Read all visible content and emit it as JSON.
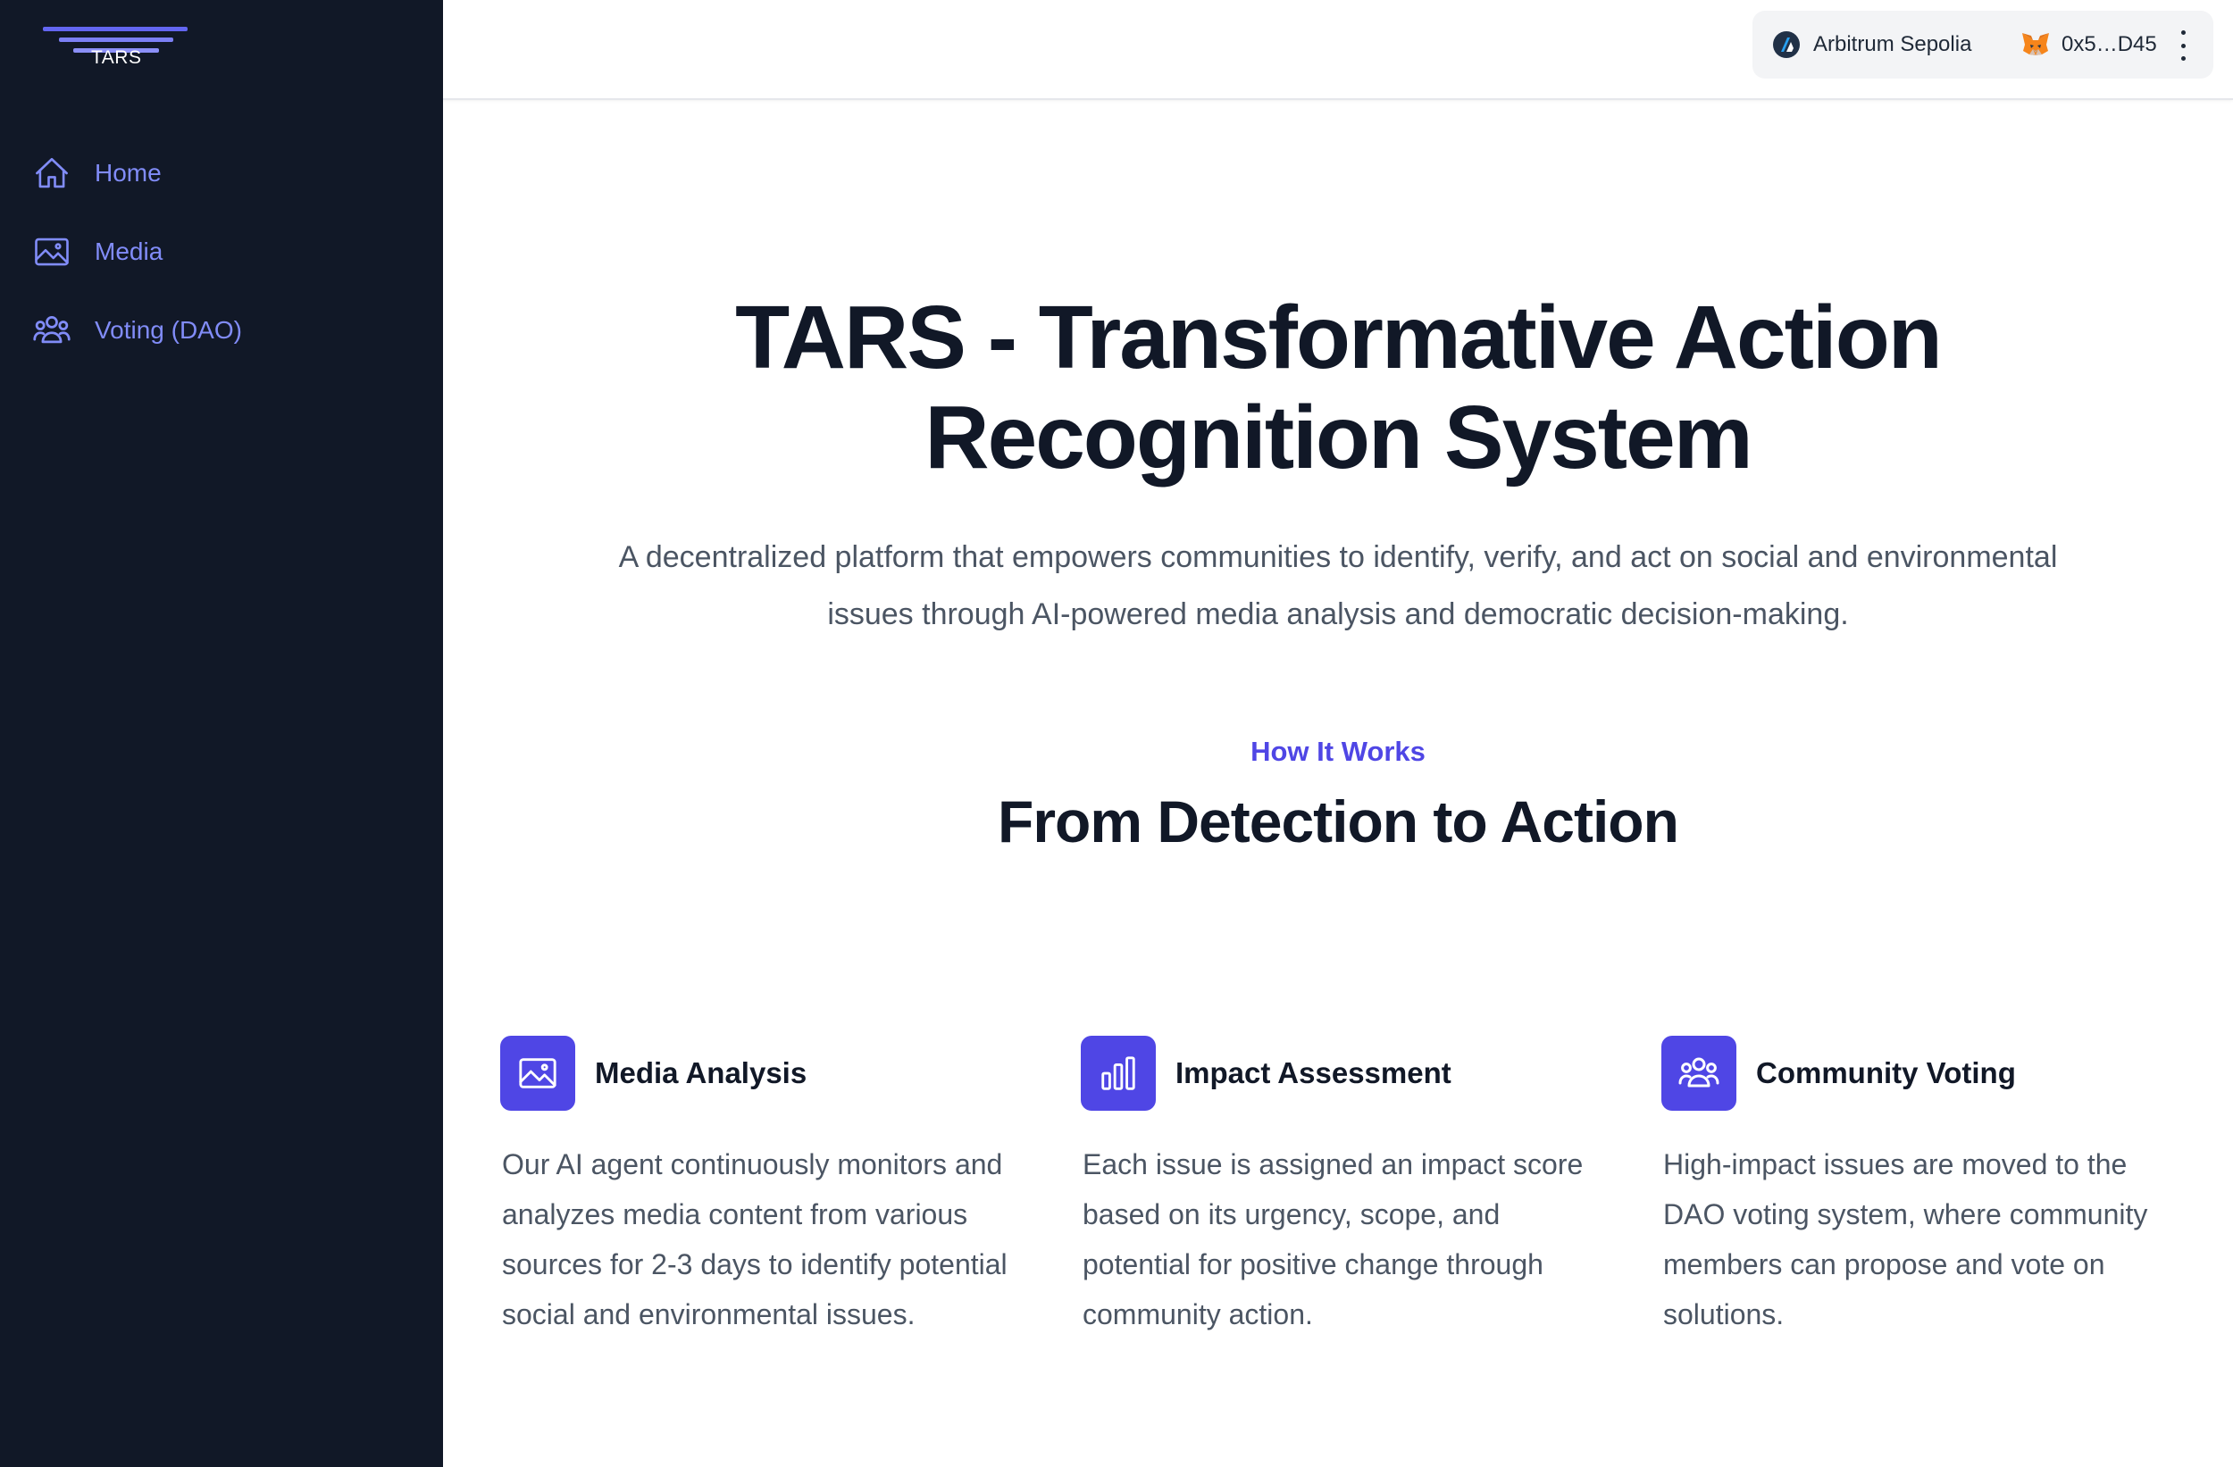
{
  "brand": {
    "logo_text": "TARS",
    "accent_color": "#4f46e5",
    "sidebar_bg": "#111827",
    "nav_color": "#818cf8"
  },
  "sidebar": {
    "items": [
      {
        "label": "Home",
        "icon": "home-icon"
      },
      {
        "label": "Media",
        "icon": "image-icon"
      },
      {
        "label": "Voting (DAO)",
        "icon": "users-icon"
      }
    ]
  },
  "header": {
    "network": "Arbitrum Sepolia",
    "network_icon": "arbitrum-logo-icon",
    "account": "0x5…D45",
    "account_icon": "metamask-fox-icon",
    "menu_icon": "more-vertical-icon"
  },
  "hero": {
    "title_line1": "TARS - Transformative Action",
    "title_line2": "Recognition System",
    "subtitle_line1": "A decentralized platform that empowers communities to identify, verify, and act on social and environmental",
    "subtitle_line2": "issues through AI-powered media analysis and democratic decision-making."
  },
  "how_it_works": {
    "eyebrow": "How It Works",
    "title": "From Detection to Action",
    "features": [
      {
        "title": "Media Analysis",
        "icon": "image-icon",
        "text": "Our AI agent continuously monitors and analyzes media content from various sources for 2-3 days to identify potential social and environmental issues."
      },
      {
        "title": "Impact Assessment",
        "icon": "bar-chart-icon",
        "text": "Each issue is assigned an impact score based on its urgency, scope, and potential for positive change through community action."
      },
      {
        "title": "Community Voting",
        "icon": "users-icon",
        "text": "High-impact issues are moved to the DAO voting system, where community members can propose and vote on solutions."
      }
    ]
  }
}
